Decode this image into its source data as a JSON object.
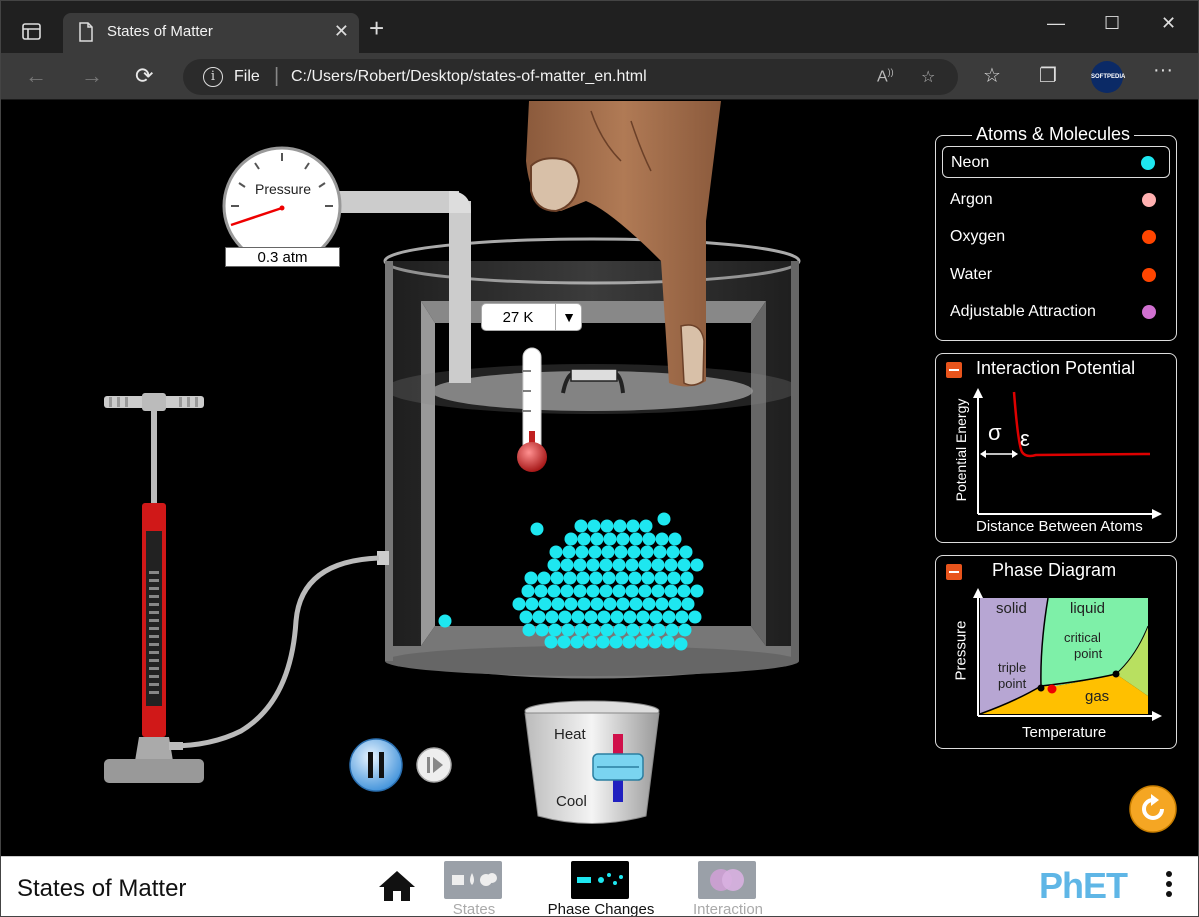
{
  "browser": {
    "tab_title": "States of Matter",
    "address_scheme": "File",
    "address_url": "C:/Users/Robert/Desktop/states-of-matter_en.html",
    "profile_label": "SOFTPEDIA"
  },
  "sim": {
    "pressure_label": "Pressure",
    "pressure_value": "0.3 atm",
    "temperature_value": "27 K",
    "heat_label": "Heat",
    "cool_label": "Cool"
  },
  "atoms_panel": {
    "title": "Atoms & Molecules",
    "items": [
      {
        "label": "Neon",
        "color": "#1ee7f0",
        "selected": true
      },
      {
        "label": "Argon",
        "color": "#ffb0b0",
        "selected": false
      },
      {
        "label": "Oxygen",
        "color": "#ff4500",
        "selected": false
      },
      {
        "label": "Water",
        "color": "#ff4500",
        "selected": false
      },
      {
        "label": "Adjustable Attraction",
        "color": "#d070d0",
        "selected": false
      }
    ]
  },
  "interaction_panel": {
    "title": "Interaction Potential",
    "ylabel": "Potential Energy",
    "xlabel": "Distance Between Atoms",
    "sigma": "σ",
    "epsilon": "ε"
  },
  "phase_panel": {
    "title": "Phase Diagram",
    "ylabel": "Pressure",
    "xlabel": "Temperature",
    "solid": "solid",
    "liquid": "liquid",
    "gas": "gas",
    "critical_1": "critical",
    "critical_2": "point",
    "triple_1": "triple",
    "triple_2": "point"
  },
  "navbar": {
    "sim_title": "States of Matter",
    "screens": [
      {
        "label": "States",
        "active": false
      },
      {
        "label": "Phase Changes",
        "active": true
      },
      {
        "label": "Interaction",
        "active": false
      }
    ],
    "logo": "PhET"
  },
  "colors": {
    "neon_atom": "#1ee7f0",
    "panel_minus": "#e8541c",
    "reset": "#f5a623"
  }
}
